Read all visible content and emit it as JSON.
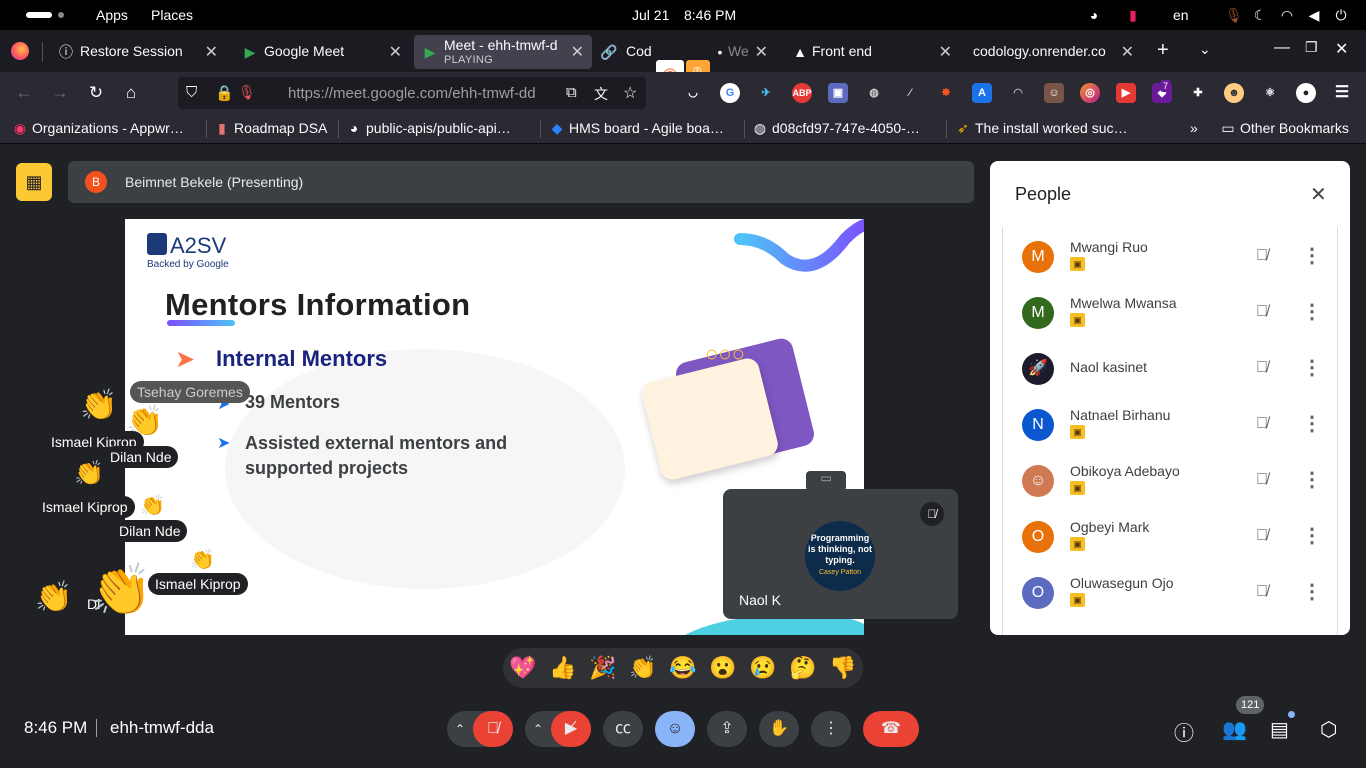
{
  "gnome_bar": {
    "apps": "Apps",
    "places": "Places",
    "date": "Jul 21",
    "time": "8:46 PM",
    "lang": "en"
  },
  "browser": {
    "tabs": [
      {
        "label": "Restore Session",
        "icon": "info-icon"
      },
      {
        "label": "Google Meet",
        "icon": "meet-icon"
      },
      {
        "label": "Meet - ehh-tmwf-d",
        "status": "PLAYING",
        "icon": "meet-icon"
      },
      {
        "label": "Cod",
        "icon": "link-icon"
      },
      {
        "label": "We",
        "icon": "dot-icon"
      },
      {
        "label": "Front end",
        "icon": "triangle-icon"
      },
      {
        "label": "codology.onrender.co",
        "icon": "none"
      }
    ],
    "url": "https://meet.google.com/ehh-tmwf-dd",
    "bookmarks": [
      {
        "label": "Organizations - Appwr…",
        "icon": "appwrite-icon"
      },
      {
        "label": "Roadmap DSA",
        "icon": "bookmark-icon"
      },
      {
        "label": "public-apis/public-api…",
        "icon": "github-icon"
      },
      {
        "label": "HMS board - Agile boa…",
        "icon": "jira-icon"
      },
      {
        "label": "d08cfd97-747e-4050-…",
        "icon": "globe-icon"
      },
      {
        "label": "The install worked suc…",
        "icon": "rocket-icon"
      }
    ],
    "other_bookmarks": "Other Bookmarks",
    "ext_badge_count": "7"
  },
  "meet": {
    "presenter": "Beimnet Bekele (Presenting)",
    "presenter_initial": "B",
    "meeting_time": "8:46 PM",
    "meeting_code": "ehh-tmwf-dda",
    "participant_count": "121",
    "self_name": "Naol K",
    "self_avatar_text": "Programming is thinking, not typing.",
    "self_avatar_author": "Casey Patton"
  },
  "slide": {
    "brand": "A2SV",
    "brand_sub": "Backed by Google",
    "title": "Mentors Information",
    "section": "Internal Mentors",
    "bullets": [
      "39 Mentors",
      "Assisted external mentors and supported projects"
    ]
  },
  "people_panel": {
    "title": "People",
    "participants": [
      {
        "name": "Mwangi Ruo",
        "initial": "M",
        "color": "#e8710a"
      },
      {
        "name": "Mwelwa Mwansa",
        "initial": "M",
        "color": "#33691e"
      },
      {
        "name": "Naol kasinet",
        "initial": "",
        "color": "#3c4043"
      },
      {
        "name": "Natnael Birhanu",
        "initial": "N",
        "color": "#0b57d0"
      },
      {
        "name": "Obikoya Adebayo",
        "initial": "",
        "color": "#d07a54"
      },
      {
        "name": "Ogbeyi Mark",
        "initial": "O",
        "color": "#e8710a"
      },
      {
        "name": "Oluwasegun Ojo",
        "initial": "O",
        "color": "#5c6bc0"
      }
    ]
  },
  "reactions": {
    "emojis": [
      "💖",
      "👍",
      "🎉",
      "👏",
      "😂",
      "😮",
      "😢",
      "🤔",
      "👎"
    ],
    "floating_names": [
      "Tsehay Goremes",
      "Ismael Kiprop",
      "Dilan Nde",
      "Ismael Kiprop",
      "Dilan Nde",
      "Ismael Kiprop",
      "Di"
    ]
  }
}
